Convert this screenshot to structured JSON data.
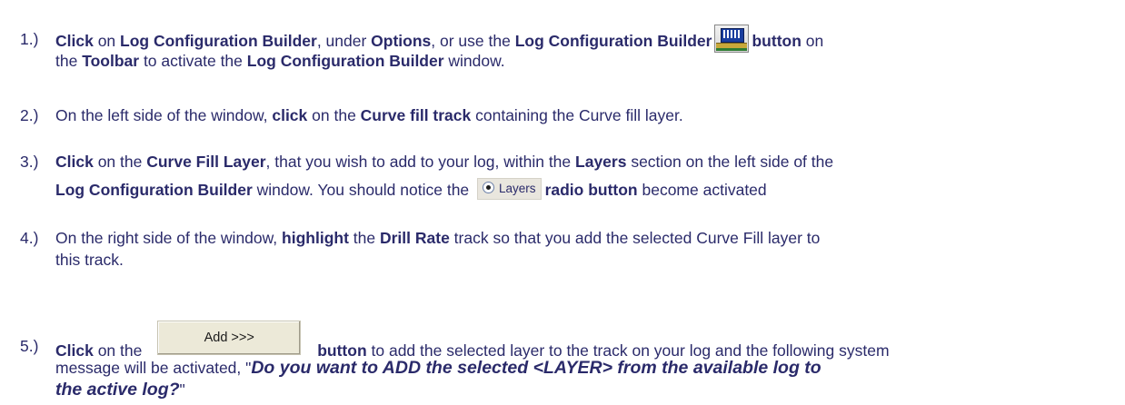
{
  "steps": [
    {
      "num": "1.)",
      "lines": [
        [
          "Click",
          " on ",
          "Log Configuration Builder",
          ", under ",
          "Options",
          ", or use the ",
          "Log Configuration Builder",
          "button",
          " on"
        ],
        [
          "the ",
          "Toolbar",
          " to activate the ",
          "Log Configuration Builder",
          " window."
        ]
      ],
      "icon": "log-configuration-builder-icon"
    },
    {
      "num": "2.)",
      "lines": [
        [
          "On the left side of the window, ",
          "click",
          " on the ",
          "Curve fill track",
          " containing the Curve fill layer."
        ]
      ]
    },
    {
      "num": "3.)",
      "lines": [
        [
          "Click",
          " on the ",
          "Curve Fill Layer",
          ", that you wish to add to your log, within the ",
          "Layers",
          " section on the left side of the"
        ],
        [
          "Log Configuration Builder",
          " window. You should notice the ",
          "Layers",
          "radio button",
          " become activated"
        ]
      ],
      "icon": "radio-button-icon"
    },
    {
      "num": "4.)",
      "lines": [
        [
          "On the right side of the window, ",
          "highlight",
          " the ",
          "Drill Rate",
          " track so that you add the selected Curve Fill layer to"
        ],
        [
          "this track."
        ]
      ]
    },
    {
      "num": "5.)",
      "lines": [
        [
          "Click",
          " on the ",
          "Add >>>",
          "button",
          " to add the selected layer to the track on your log and the following system"
        ],
        [
          "message will be activated, \"",
          "Do you want to ADD the selected <LAYER> from the available log to",
          ""
        ],
        [
          "the active log?",
          "\""
        ]
      ]
    }
  ],
  "colors": {
    "text": "#2a2a6a",
    "screen": "#1a3e9e"
  }
}
